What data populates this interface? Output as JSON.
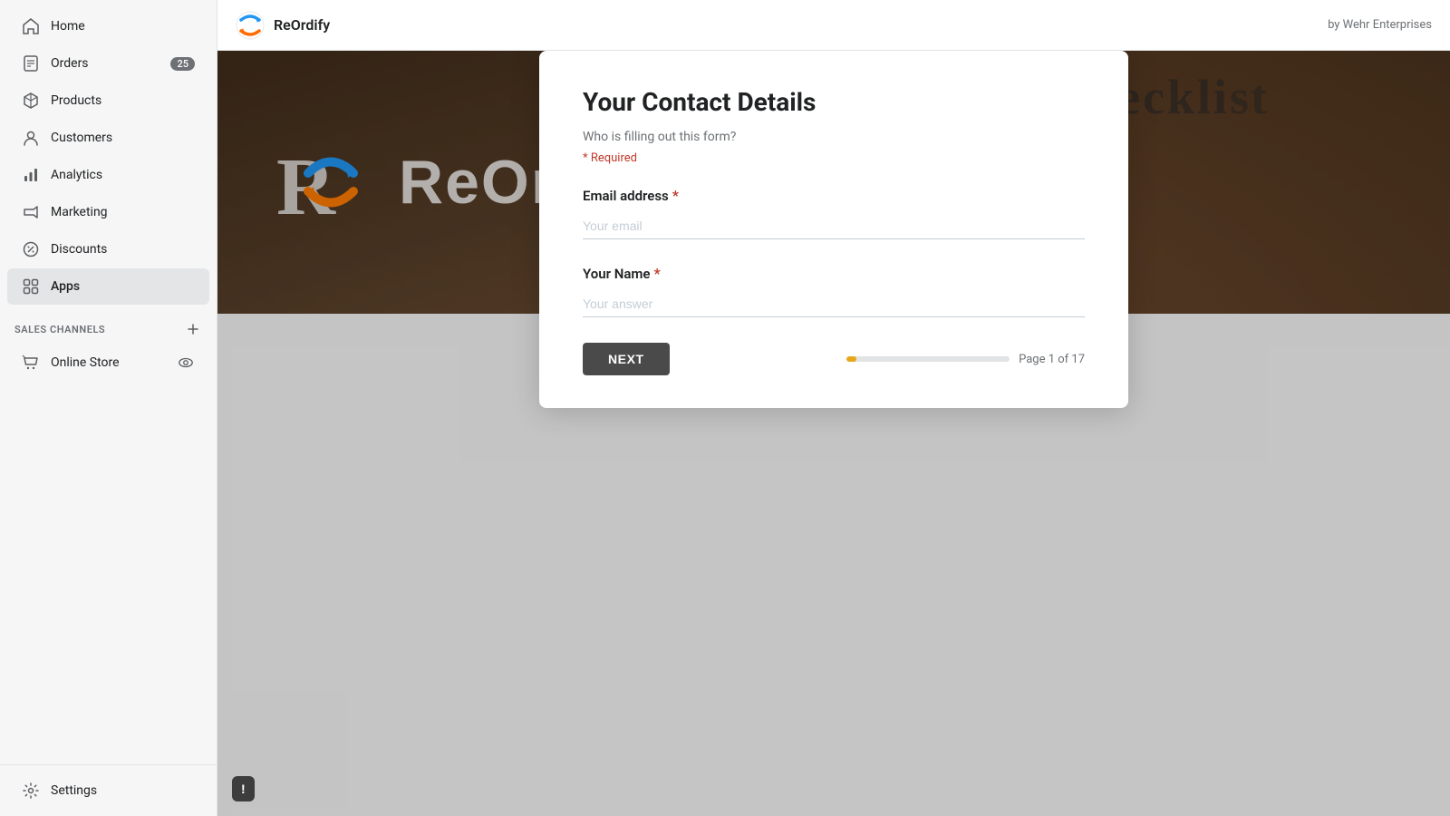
{
  "sidebar": {
    "nav_items": [
      {
        "id": "home",
        "label": "Home",
        "icon": "home",
        "badge": null,
        "active": false
      },
      {
        "id": "orders",
        "label": "Orders",
        "icon": "orders",
        "badge": "25",
        "active": false
      },
      {
        "id": "products",
        "label": "Products",
        "icon": "products",
        "badge": null,
        "active": false
      },
      {
        "id": "customers",
        "label": "Customers",
        "icon": "customers",
        "badge": null,
        "active": false
      },
      {
        "id": "analytics",
        "label": "Analytics",
        "icon": "analytics",
        "badge": null,
        "active": false
      },
      {
        "id": "marketing",
        "label": "Marketing",
        "icon": "marketing",
        "badge": null,
        "active": false
      },
      {
        "id": "discounts",
        "label": "Discounts",
        "icon": "discounts",
        "badge": null,
        "active": false
      },
      {
        "id": "apps",
        "label": "Apps",
        "icon": "apps",
        "badge": null,
        "active": true
      }
    ],
    "section_header": "SALES CHANNELS",
    "channels": [
      {
        "id": "online-store",
        "label": "Online Store"
      }
    ],
    "settings_label": "Settings"
  },
  "topbar": {
    "app_name": "ReOrdify",
    "by_text": "by Wehr Enterprises"
  },
  "hero": {
    "brand_text": "ReOrdify",
    "checklist_text": "Checklist"
  },
  "form": {
    "title": "Your Contact Details",
    "subtitle": "Who is filling out this form?",
    "required_note": "* Required",
    "fields": [
      {
        "id": "email",
        "label": "Email address",
        "required": true,
        "placeholder": "Your email",
        "value": ""
      },
      {
        "id": "name",
        "label": "Your Name",
        "required": true,
        "placeholder": "Your answer",
        "value": ""
      }
    ],
    "next_button_label": "NEXT",
    "progress": {
      "current_page": 1,
      "total_pages": 17,
      "page_text": "Page 1 of 17",
      "fill_percent": 5.88
    }
  },
  "feedback": {
    "icon": "exclamation",
    "label": ""
  }
}
